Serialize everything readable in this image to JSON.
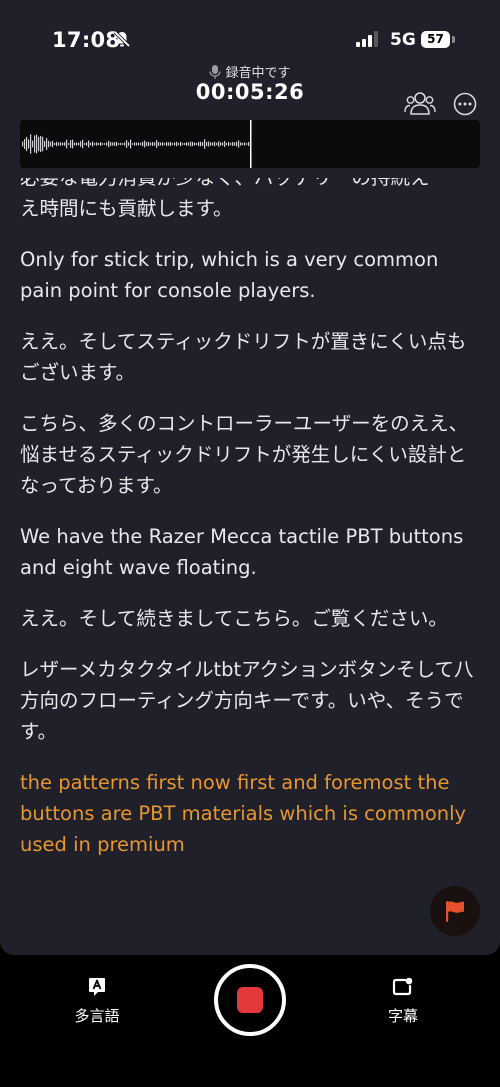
{
  "status_bar": {
    "time": "17:08",
    "network": "5G",
    "battery": "57"
  },
  "recording": {
    "status": "録音中です",
    "timer": "00:05:26"
  },
  "transcript": [
    {
      "text": "必要な電力消費が少なく、バッテリーの持続え",
      "live": false
    },
    {
      "text": "え時間にも貢献します。",
      "live": false
    },
    {
      "text": "Only for stick trip, which is a very common pain point for console players.",
      "live": false
    },
    {
      "text": "ええ。そしてスティックドリフトが置きにくい点もございます。",
      "live": false
    },
    {
      "text": "こちら、多くのコントローラーユーザーをのええ、悩ませるスティックドリフトが発生しにくい設計となっております。",
      "live": false
    },
    {
      "text": "We have the Razer Mecca tactile PBT buttons and eight wave floating.",
      "live": false
    },
    {
      "text": "ええ。そして続きましてこちら。ご覧ください。",
      "live": false
    },
    {
      "text": "レザーメカタクタイルtbtアクションボタンそして八方向のフローティング方向キーです。いや、そうです。",
      "live": false
    },
    {
      "text": "the patterns first now first and foremost the buttons are PBT materials which is commonly used in premium",
      "live": true
    }
  ],
  "bottom_bar": {
    "multilang_label": "多言語",
    "subtitles_label": "字幕"
  },
  "colors": {
    "background": "#1f2029",
    "live_text": "#e8962e",
    "record": "#e5383b",
    "flag": "#e8502a"
  },
  "icons": [
    "mute-icon",
    "signal-icon",
    "battery-icon",
    "mic-icon",
    "people-icon",
    "more-icon",
    "flag-icon",
    "language-icon",
    "subtitle-icon"
  ]
}
